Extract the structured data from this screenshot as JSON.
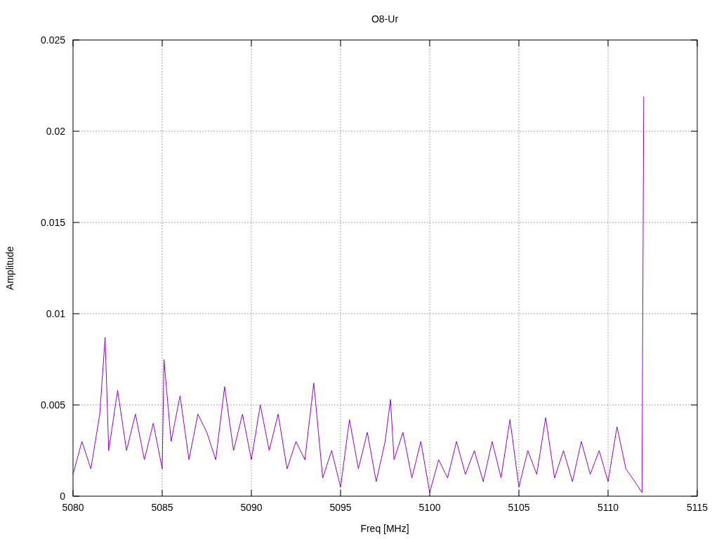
{
  "chart_data": {
    "type": "line",
    "title": "O8-Ur",
    "xlabel": "Freq [MHz]",
    "ylabel": "Amplitude",
    "grid": true,
    "xlim": [
      5080,
      5115
    ],
    "ylim": [
      0,
      0.025
    ],
    "xticks": [
      5080,
      5085,
      5090,
      5095,
      5100,
      5105,
      5110,
      5115
    ],
    "yticks": [
      0,
      0.005,
      0.01,
      0.015,
      0.02,
      0.025
    ],
    "x": [
      5080,
      5080.5,
      5081,
      5081.5,
      5081.8,
      5082,
      5082.5,
      5083,
      5083.5,
      5084,
      5084.5,
      5085,
      5085.1,
      5085.5,
      5086,
      5086.5,
      5087,
      5087.5,
      5088,
      5088.5,
      5089,
      5089.5,
      5090,
      5090.5,
      5091,
      5091.5,
      5092,
      5092.5,
      5093,
      5093.5,
      5094,
      5094.5,
      5095,
      5095.5,
      5096,
      5096.5,
      5097,
      5097.5,
      5097.8,
      5098,
      5098.5,
      5099,
      5099.5,
      5100,
      5100.5,
      5101,
      5101.5,
      5102,
      5102.5,
      5103,
      5103.5,
      5104,
      5104.5,
      5105,
      5105.5,
      5106,
      5106.5,
      5107,
      5107.5,
      5108,
      5108.5,
      5109,
      5109.5,
      5110,
      5110.5,
      5111,
      5111.5,
      5111.9,
      5112
    ],
    "series": [
      {
        "color": "#9400d3",
        "values": [
          0.0012,
          0.003,
          0.0015,
          0.0045,
          0.0087,
          0.0025,
          0.0058,
          0.0025,
          0.0045,
          0.002,
          0.004,
          0.0015,
          0.0075,
          0.003,
          0.0055,
          0.002,
          0.0045,
          0.0035,
          0.002,
          0.006,
          0.0025,
          0.0045,
          0.002,
          0.005,
          0.0025,
          0.0045,
          0.0015,
          0.003,
          0.002,
          0.0062,
          0.001,
          0.0025,
          0.0005,
          0.0042,
          0.0015,
          0.0035,
          0.0008,
          0.003,
          0.0053,
          0.002,
          0.0035,
          0.001,
          0.003,
          0.0002,
          0.002,
          0.001,
          0.003,
          0.0012,
          0.0025,
          0.0008,
          0.003,
          0.001,
          0.0042,
          0.0005,
          0.0025,
          0.0012,
          0.0043,
          0.001,
          0.0025,
          0.0008,
          0.003,
          0.0012,
          0.0025,
          0.0008,
          0.0038,
          0.0015,
          0.0008,
          0.0002,
          0.0219
        ]
      }
    ]
  }
}
